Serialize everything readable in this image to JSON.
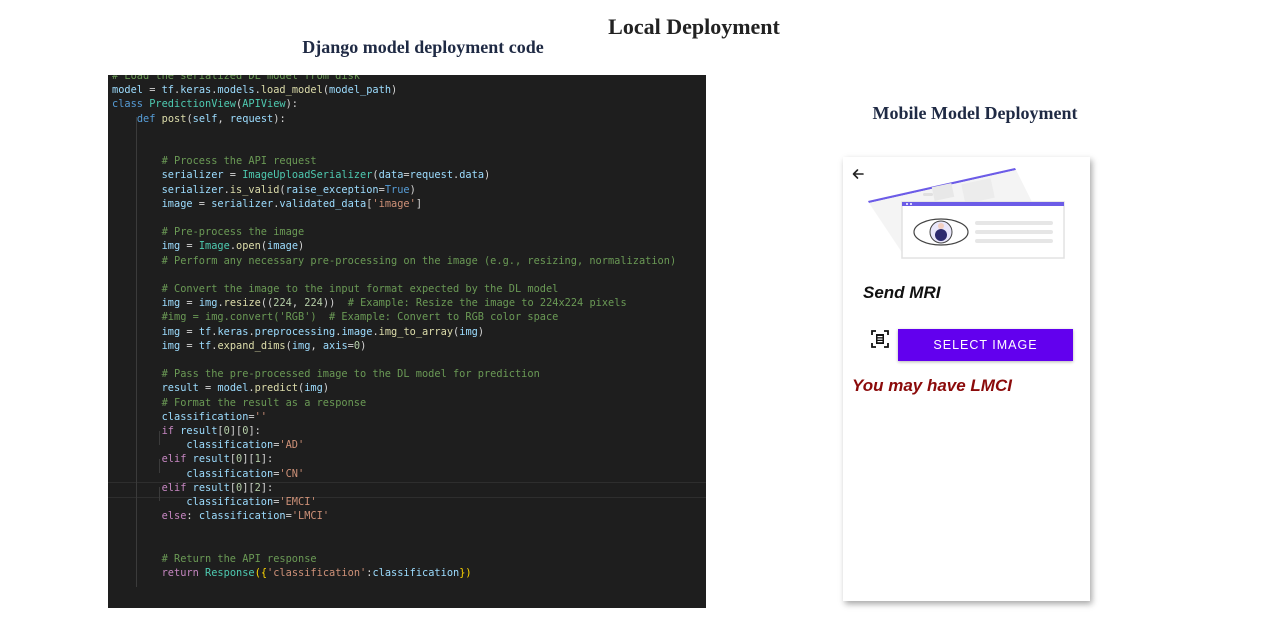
{
  "titles": {
    "main": "Local Deployment",
    "code_section": "Django model deployment code",
    "mobile_section": "Mobile Model Deployment"
  },
  "code": {
    "lines": [
      [
        [
          "cm",
          "# Load the serialized DL model from disk"
        ]
      ],
      [
        [
          "var",
          "model"
        ],
        [
          "",
          " = "
        ],
        [
          "var",
          "tf"
        ],
        [
          "",
          "."
        ],
        [
          "var",
          "keras"
        ],
        [
          "",
          "."
        ],
        [
          "var",
          "models"
        ],
        [
          "",
          "."
        ],
        [
          "fn",
          "load_model"
        ],
        [
          "",
          "("
        ],
        [
          "var",
          "model_path"
        ],
        [
          "",
          ")"
        ]
      ],
      [
        [
          "kw2",
          "class"
        ],
        [
          "",
          " "
        ],
        [
          "cls",
          "PredictionView"
        ],
        [
          "",
          "("
        ],
        [
          "cls",
          "APIView"
        ],
        [
          "",
          "):"
        ]
      ],
      [
        [
          "",
          "    "
        ],
        [
          "kw2",
          "def"
        ],
        [
          "",
          " "
        ],
        [
          "fn",
          "post"
        ],
        [
          "",
          "("
        ],
        [
          "var",
          "self"
        ],
        [
          "",
          ", "
        ],
        [
          "var",
          "request"
        ],
        [
          "",
          "):"
        ]
      ],
      [
        [
          "",
          ""
        ]
      ],
      [
        [
          "",
          ""
        ]
      ],
      [
        [
          "",
          "        "
        ],
        [
          "cm",
          "# Process the API request"
        ]
      ],
      [
        [
          "",
          "        "
        ],
        [
          "var",
          "serializer"
        ],
        [
          "",
          " = "
        ],
        [
          "cls",
          "ImageUploadSerializer"
        ],
        [
          "",
          "("
        ],
        [
          "var",
          "data"
        ],
        [
          "",
          "="
        ],
        [
          "var",
          "request"
        ],
        [
          "",
          "."
        ],
        [
          "var",
          "data"
        ],
        [
          "",
          ")"
        ]
      ],
      [
        [
          "",
          "        "
        ],
        [
          "var",
          "serializer"
        ],
        [
          "",
          "."
        ],
        [
          "fn",
          "is_valid"
        ],
        [
          "",
          "("
        ],
        [
          "var",
          "raise_exception"
        ],
        [
          "",
          "="
        ],
        [
          "kw2",
          "True"
        ],
        [
          "",
          ")"
        ]
      ],
      [
        [
          "",
          "        "
        ],
        [
          "var",
          "image"
        ],
        [
          "",
          " = "
        ],
        [
          "var",
          "serializer"
        ],
        [
          "",
          "."
        ],
        [
          "var",
          "validated_data"
        ],
        [
          "",
          "["
        ],
        [
          "str",
          "'image'"
        ],
        [
          "",
          "]"
        ]
      ],
      [
        [
          "",
          ""
        ]
      ],
      [
        [
          "",
          "        "
        ],
        [
          "cm",
          "# Pre-process the image"
        ]
      ],
      [
        [
          "",
          "        "
        ],
        [
          "var",
          "img"
        ],
        [
          "",
          " = "
        ],
        [
          "cls",
          "Image"
        ],
        [
          "",
          "."
        ],
        [
          "fn",
          "open"
        ],
        [
          "",
          "("
        ],
        [
          "var",
          "image"
        ],
        [
          "",
          ")"
        ]
      ],
      [
        [
          "",
          "        "
        ],
        [
          "cm",
          "# Perform any necessary pre-processing on the image (e.g., resizing, normalization)"
        ]
      ],
      [
        [
          "",
          ""
        ]
      ],
      [
        [
          "",
          "        "
        ],
        [
          "cm",
          "# Convert the image to the input format expected by the DL model"
        ]
      ],
      [
        [
          "",
          "        "
        ],
        [
          "var",
          "img"
        ],
        [
          "",
          " = "
        ],
        [
          "var",
          "img"
        ],
        [
          "",
          "."
        ],
        [
          "fn",
          "resize"
        ],
        [
          "",
          "(("
        ],
        [
          "num",
          "224"
        ],
        [
          "",
          ", "
        ],
        [
          "num",
          "224"
        ],
        [
          "",
          "))  "
        ],
        [
          "cm",
          "# Example: Resize the image to 224x224 pixels"
        ]
      ],
      [
        [
          "",
          "        "
        ],
        [
          "cm",
          "#img = img.convert('RGB')  # Example: Convert to RGB color space"
        ]
      ],
      [
        [
          "",
          "        "
        ],
        [
          "var",
          "img"
        ],
        [
          "",
          " = "
        ],
        [
          "var",
          "tf"
        ],
        [
          "",
          "."
        ],
        [
          "var",
          "keras"
        ],
        [
          "",
          "."
        ],
        [
          "var",
          "preprocessing"
        ],
        [
          "",
          "."
        ],
        [
          "var",
          "image"
        ],
        [
          "",
          "."
        ],
        [
          "fn",
          "img_to_array"
        ],
        [
          "",
          "("
        ],
        [
          "var",
          "img"
        ],
        [
          "",
          ")"
        ]
      ],
      [
        [
          "",
          "        "
        ],
        [
          "var",
          "img"
        ],
        [
          "",
          " = "
        ],
        [
          "var",
          "tf"
        ],
        [
          "",
          "."
        ],
        [
          "fn",
          "expand_dims"
        ],
        [
          "",
          "("
        ],
        [
          "var",
          "img"
        ],
        [
          "",
          ", "
        ],
        [
          "var",
          "axis"
        ],
        [
          "",
          "="
        ],
        [
          "num",
          "0"
        ],
        [
          "",
          ")"
        ]
      ],
      [
        [
          "",
          ""
        ]
      ],
      [
        [
          "",
          "        "
        ],
        [
          "cm",
          "# Pass the pre-processed image to the DL model for prediction"
        ]
      ],
      [
        [
          "",
          "        "
        ],
        [
          "var",
          "result"
        ],
        [
          "",
          " = "
        ],
        [
          "var",
          "model"
        ],
        [
          "",
          "."
        ],
        [
          "fn",
          "predict"
        ],
        [
          "",
          "("
        ],
        [
          "var",
          "img"
        ],
        [
          "",
          ")"
        ]
      ],
      [
        [
          "",
          "        "
        ],
        [
          "cm",
          "# Format the result as a response"
        ]
      ],
      [
        [
          "",
          "        "
        ],
        [
          "var",
          "classification"
        ],
        [
          "",
          "="
        ],
        [
          "str",
          "''"
        ]
      ],
      [
        [
          "",
          "        "
        ],
        [
          "kw",
          "if"
        ],
        [
          "",
          " "
        ],
        [
          "var",
          "result"
        ],
        [
          "",
          "["
        ],
        [
          "num",
          "0"
        ],
        [
          "",
          "]["
        ],
        [
          "num",
          "0"
        ],
        [
          "",
          "]:"
        ]
      ],
      [
        [
          "",
          "            "
        ],
        [
          "var",
          "classification"
        ],
        [
          "",
          "="
        ],
        [
          "str",
          "'AD'"
        ]
      ],
      [
        [
          "",
          "        "
        ],
        [
          "kw",
          "elif"
        ],
        [
          "",
          " "
        ],
        [
          "var",
          "result"
        ],
        [
          "",
          "["
        ],
        [
          "num",
          "0"
        ],
        [
          "",
          "]["
        ],
        [
          "num",
          "1"
        ],
        [
          "",
          "]:"
        ]
      ],
      [
        [
          "",
          "            "
        ],
        [
          "var",
          "classification"
        ],
        [
          "",
          "="
        ],
        [
          "str",
          "'CN'"
        ]
      ],
      [
        [
          "",
          "        "
        ],
        [
          "kw",
          "elif"
        ],
        [
          "",
          " "
        ],
        [
          "var",
          "result"
        ],
        [
          "",
          "["
        ],
        [
          "num",
          "0"
        ],
        [
          "",
          "]["
        ],
        [
          "num",
          "2"
        ],
        [
          "",
          "]:"
        ]
      ],
      [
        [
          "",
          "            "
        ],
        [
          "var",
          "classification"
        ],
        [
          "",
          "="
        ],
        [
          "str",
          "'EMCI'"
        ]
      ],
      [
        [
          "",
          "        "
        ],
        [
          "kw",
          "else"
        ],
        [
          "",
          ": "
        ],
        [
          "var",
          "classification"
        ],
        [
          "",
          "="
        ],
        [
          "str",
          "'LMCI'"
        ]
      ],
      [
        [
          "",
          ""
        ]
      ],
      [
        [
          "",
          ""
        ]
      ],
      [
        [
          "",
          "        "
        ],
        [
          "cm",
          "# Return the API response"
        ]
      ],
      [
        [
          "",
          "        "
        ],
        [
          "kw",
          "return"
        ],
        [
          "",
          " "
        ],
        [
          "cls",
          "Response"
        ],
        [
          "br",
          "({"
        ],
        [
          "str",
          "'classification'"
        ],
        [
          "",
          ":"
        ],
        [
          "var",
          "classification"
        ],
        [
          "br",
          "})"
        ]
      ]
    ]
  },
  "mobile": {
    "send_label": "Send MRI",
    "select_button": "SELECT IMAGE",
    "result_text": "You may have LMCI",
    "icons": {
      "back": "arrow-back-icon",
      "scan": "document-scanner-icon"
    },
    "colors": {
      "button": "#6200ee",
      "result": "#8b0a0a",
      "illustration_accent": "#6c5ce7"
    }
  }
}
